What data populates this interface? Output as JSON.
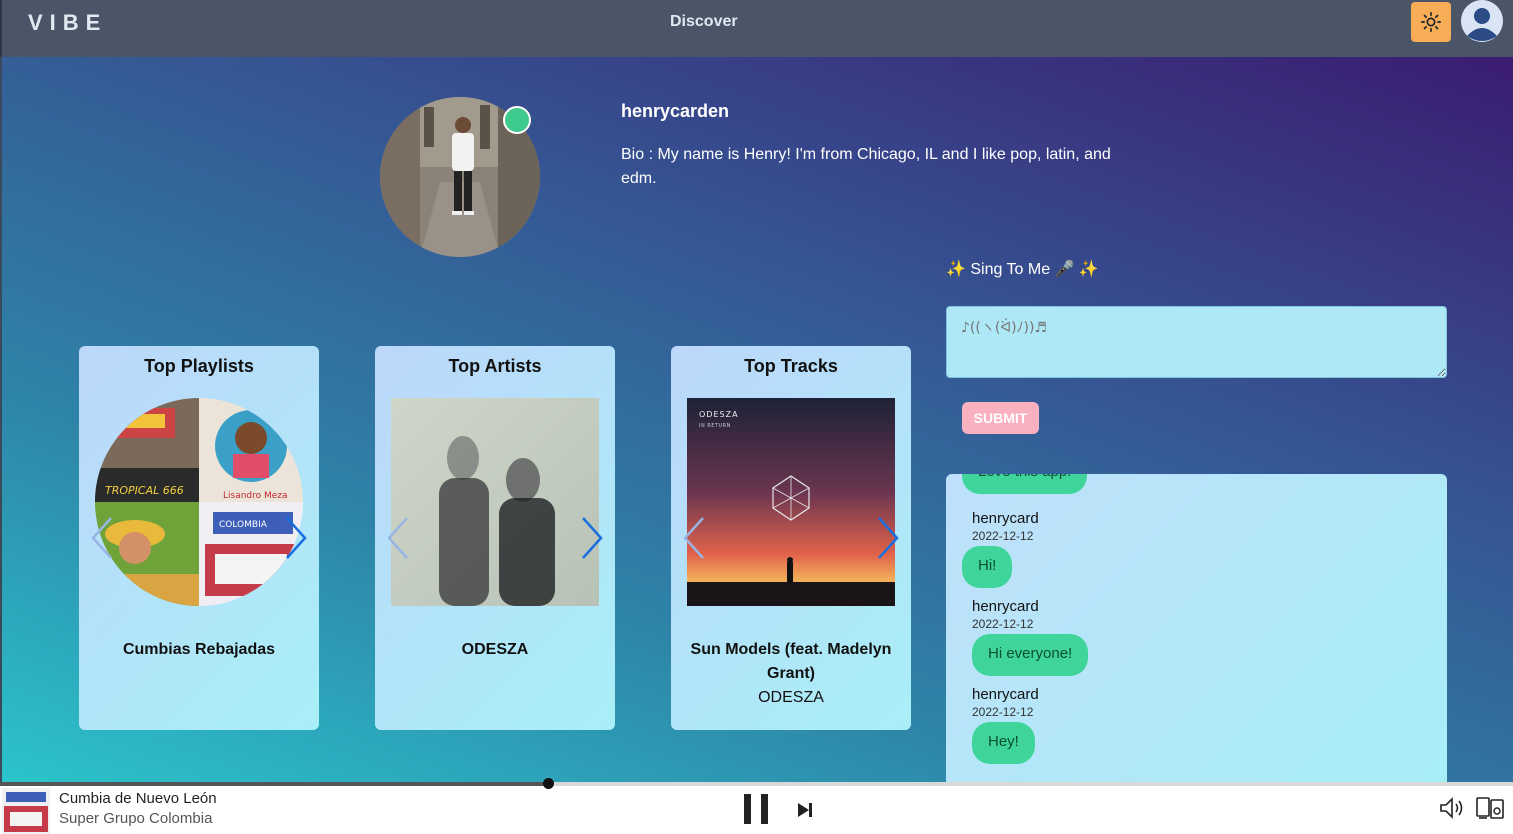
{
  "header": {
    "logo": "VIBE",
    "nav_discover": "Discover",
    "theme_icon": "sun-icon",
    "avatar_icon": "user-avatar-icon"
  },
  "profile": {
    "username": "henrycarden",
    "bio": "Bio : My name is Henry! I'm from Chicago, IL and I like pop, latin, and edm.",
    "status": "online"
  },
  "cards": {
    "playlists": {
      "title": "Top Playlists",
      "name": "Cumbias Rebajadas"
    },
    "artists": {
      "title": "Top Artists",
      "name": "ODESZA"
    },
    "tracks": {
      "title": "Top Tracks",
      "name": "Sun Models (feat. Madelyn Grant)",
      "artist": "ODESZA",
      "cover_text": "ODESZA",
      "cover_subtext": "IN RETURN"
    }
  },
  "sing": {
    "label": "✨ Sing To Me 🎤 ✨",
    "placeholder": "♪((ヽ(ᐛ)ﾉ))♬",
    "submit_label": "SUBMIT"
  },
  "chat": {
    "partial_message": "Love this app!",
    "messages": [
      {
        "user": "henrycard",
        "date": "2022-12-12",
        "text": "Hi!"
      },
      {
        "user": "henrycard",
        "date": "2022-12-12",
        "text": "Hi everyone!"
      },
      {
        "user": "henrycard",
        "date": "2022-12-12",
        "text": "Hey!"
      }
    ]
  },
  "player": {
    "track_title": "Cumbia de Nuevo León",
    "track_artist": "Super Grupo Colombia",
    "progress_fraction": 0.36,
    "state": "playing"
  },
  "colors": {
    "header_bg": "#4a5568",
    "accent_orange": "#f6ad55",
    "online_green": "#3ec98d",
    "bubble_green": "#3fd59a",
    "submit_pink": "#f9b0bf"
  }
}
